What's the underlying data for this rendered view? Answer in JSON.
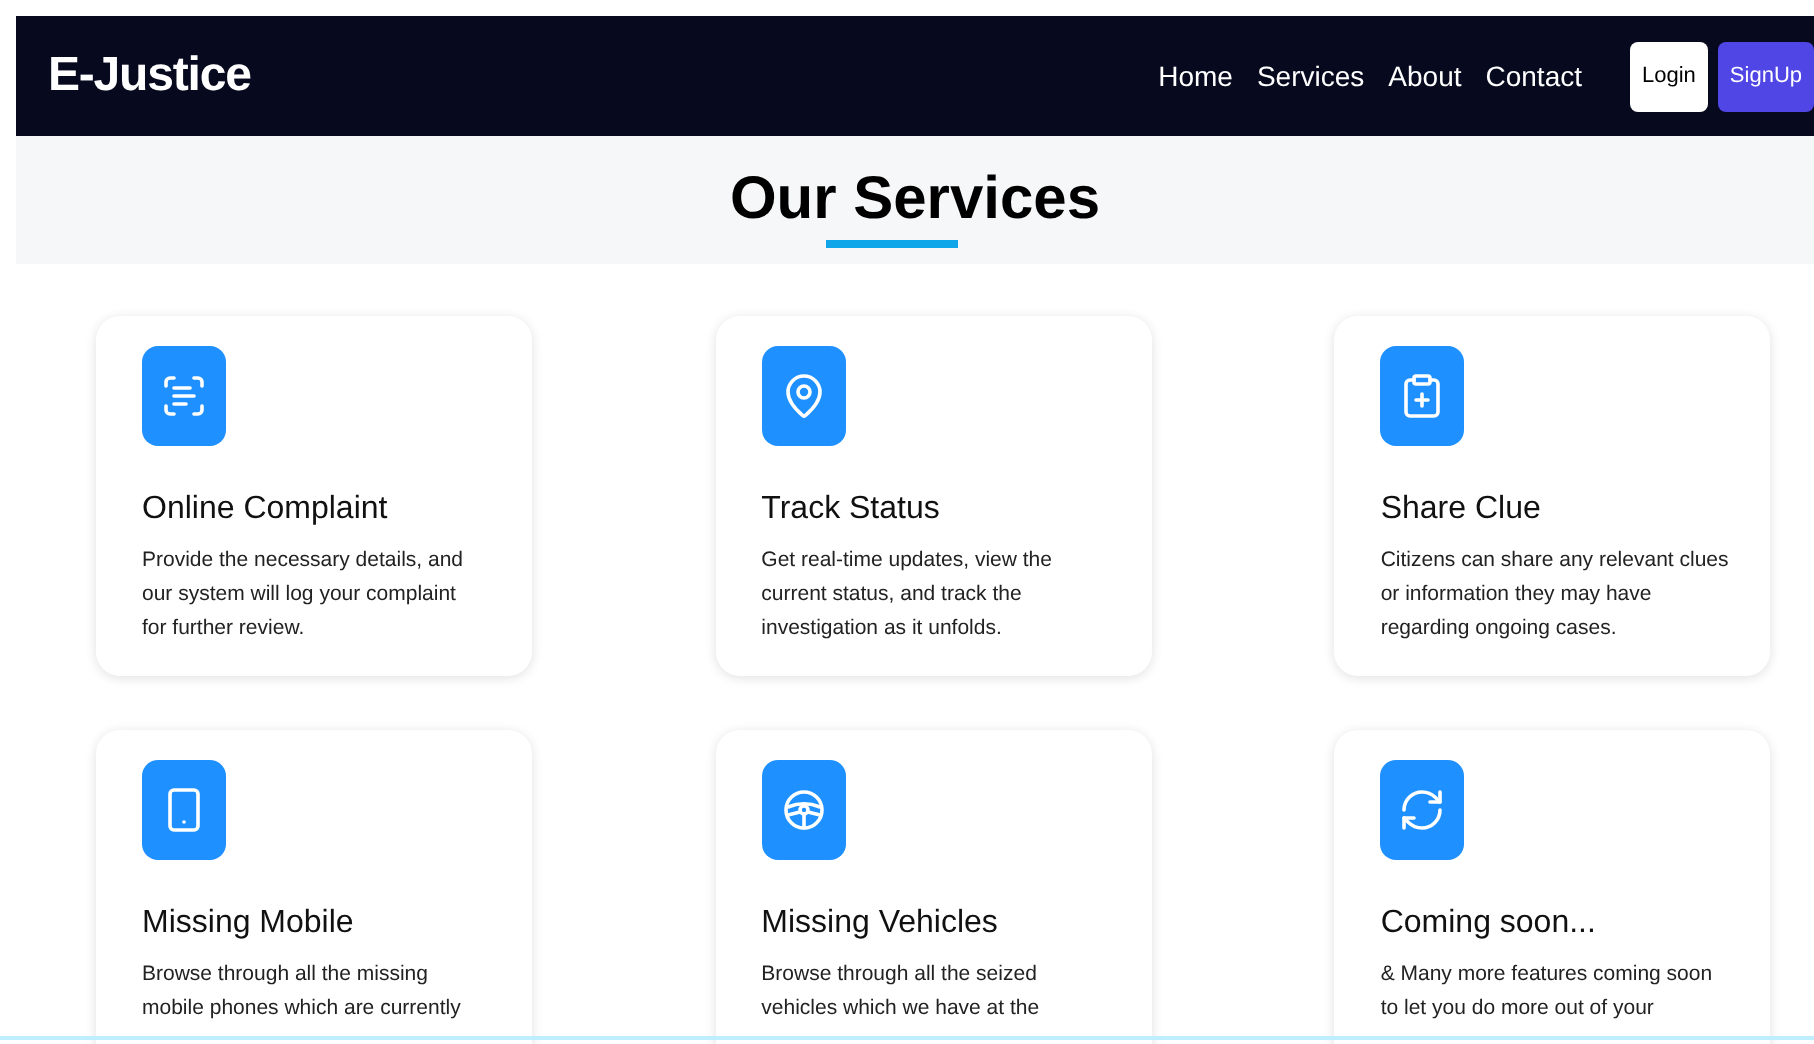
{
  "navbar": {
    "brand": "E-Justice",
    "links": [
      {
        "label": "Home"
      },
      {
        "label": "Services"
      },
      {
        "label": "About"
      },
      {
        "label": "Contact"
      }
    ],
    "buttons": [
      {
        "label": "Login",
        "kind": "outline"
      },
      {
        "label": "SignUp",
        "kind": "primary"
      }
    ]
  },
  "heading": "Our Services",
  "services": [
    {
      "kind": "document",
      "title": "Online Complaint",
      "lines": [
        "Provide the necessary details, and",
        "our system will log your complaint",
        "for further review."
      ]
    },
    {
      "kind": "pin",
      "title": "Track Status",
      "lines": [
        "Get real-time updates, view the",
        "current status, and track the",
        "investigation as it unfolds."
      ]
    },
    {
      "kind": "clue",
      "title": "Share Clue",
      "lines": [
        "Citizens can share any relevant clues",
        "or information they may have",
        "regarding ongoing cases."
      ]
    },
    {
      "kind": "phone",
      "title": "Missing Mobile",
      "lines": [
        "Browse through all the missing",
        "mobile phones which are currently"
      ]
    },
    {
      "kind": "wheel",
      "title": "Missing Vehicles",
      "lines": [
        "Browse through all the seized",
        "vehicles which we have at the"
      ]
    },
    {
      "kind": "refresh",
      "title": "Coming soon...",
      "lines": [
        "& Many more features coming soon",
        "to let you do more out of your"
      ]
    }
  ]
}
